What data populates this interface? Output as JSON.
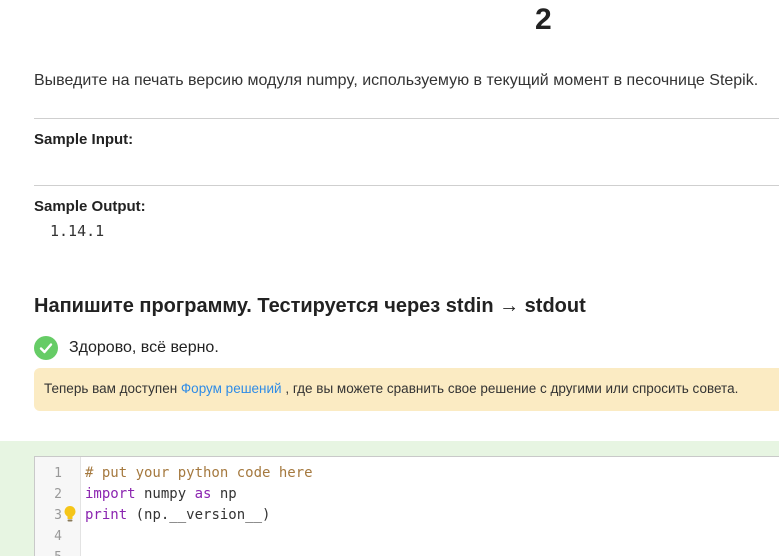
{
  "step": {
    "number": "2"
  },
  "task": {
    "description": "Выведите на печать версию модуля numpy, используемую в текущий момент в песочнице Stepik."
  },
  "samples": {
    "input_label": "Sample Input:",
    "input_value": "",
    "output_label": "Sample Output:",
    "output_value": "1.14.1"
  },
  "submission": {
    "heading": "Напишите программу. Тестируется через stdin → stdout",
    "result_text": "Здорово, всё верно.",
    "notice_before": "Теперь вам доступен ",
    "notice_link": "Форум решений",
    "notice_after": " , где вы можете сравнить свое решение с другими или спросить совета."
  },
  "editor": {
    "line_numbers": [
      "1",
      "2",
      "3",
      "4",
      "5"
    ],
    "lines": [
      {
        "comment": "# put your python code here"
      },
      {
        "kw1": "import",
        "t1": " numpy ",
        "kw2": "as",
        "t2": " np"
      },
      {
        "kw1": "print",
        "t1": " (np.__version__)"
      }
    ]
  },
  "colors": {
    "success_green": "#66cc66",
    "notice_bg": "#fbebc3",
    "link_blue": "#2f8ce6",
    "editor_area_bg": "#e7f5e2"
  }
}
